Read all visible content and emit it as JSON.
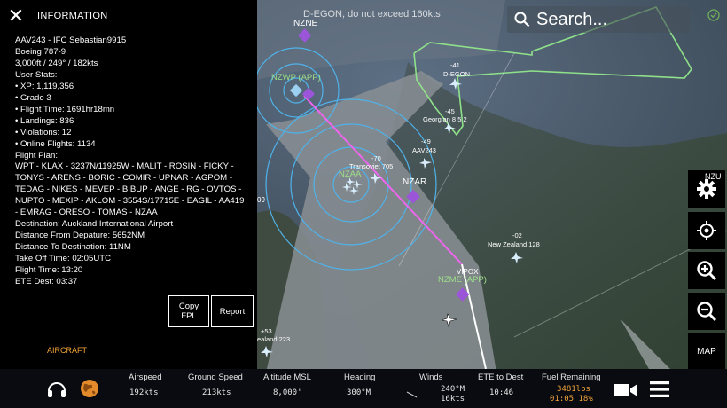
{
  "notice": "D-EGON, do not exceed 160kts",
  "search": {
    "placeholder": "Search..."
  },
  "info": {
    "title": "INFORMATION",
    "callsign": "AAV243 - IFC Sebastian9915",
    "aircraft": "Boeing 787-9",
    "state": "3,000ft / 249° / 182kts",
    "user_stats_label": "User Stats:",
    "stats": [
      "XP: 1,119,356",
      "Grade 3",
      "Flight Time: 1691hr18mn",
      "Landings: 836",
      "Violations: 12",
      "Online Flights: 1134"
    ],
    "flight_plan_label": "Flight Plan:",
    "flight_plan": "WPT - KLAX - 3237N/11925W - MALIT - ROSIN - FICKY - TONYS - ARENS - BORIC - COMIR - UPNAR - AGPOM - TEDAG - NIKES - MEVEP - BIBUP - ANGE - RG - OVTOS - NUPTO - MEXIP - AKLOM - 3554S/17715E - EAGIL - AA419 - EMRAG - ORESO - TOMAS - NZAA",
    "destination": "Destination: Auckland International Airport",
    "dist_from_dep": "Distance From Depature: 5652NM",
    "dist_to_dest": "Distance To Destination: 11NM",
    "takeoff": "Take Off Time: 02:05UTC",
    "flight_time": "Flight Time: 13:20",
    "ete_dest": "ETE Dest: 03:37",
    "copy_fpl_line1": "Copy",
    "copy_fpl_line2": "FPL",
    "report": "Report",
    "aircraft_tab": "AIRCRAFT"
  },
  "map": {
    "airports": [
      {
        "id": "NZNE",
        "label": "NZNE",
        "color": "#ffffff"
      },
      {
        "id": "NZWP",
        "label": "NZWP (APP)",
        "color": "#9ee08a"
      },
      {
        "id": "NZAA",
        "label": "NZAA",
        "color": "#9ee08a"
      },
      {
        "id": "NZAR",
        "label": "NZAR",
        "color": "#ffffff"
      },
      {
        "id": "NZME",
        "label": "NZME (APP)",
        "color": "#9ee08a"
      }
    ],
    "traffic": [
      {
        "alt": "-41",
        "callsign": "D-EGON"
      },
      {
        "alt": "-45",
        "callsign": "Georgian 8 5 2"
      },
      {
        "alt": "-49",
        "callsign": "AAV243"
      },
      {
        "alt": "-70",
        "callsign": "Transoviet 705"
      },
      {
        "alt": "-02",
        "callsign": "New Zealand 128"
      },
      {
        "alt": "+53",
        "callsign": "ealand 223"
      }
    ],
    "waypoint": "VIPOX",
    "edge_label": "09",
    "nzu_label": "NZU"
  },
  "buttons": {
    "map": "MAP"
  },
  "bottom": {
    "airspeed_label": "Airspeed",
    "airspeed": "192kts",
    "gs_label": "Ground Speed",
    "gs": "213kts",
    "alt_label": "Altitude MSL",
    "alt": "8,000'",
    "heading_label": "Heading",
    "heading": "300°M",
    "winds_label": "Winds",
    "winds_dir": "240°M",
    "winds_speed": "16kts",
    "ete_label": "ETE to Dest",
    "ete": "10:46",
    "fuel_label": "Fuel Remaining",
    "fuel": "3481lbs",
    "fuel_time": "01:05 18%"
  },
  "colors": {
    "accent_orange": "#f2a33a",
    "route_magenta": "#ee66ee",
    "range_ring": "#4fb3ea",
    "airport_purple": "#9b55d8"
  }
}
